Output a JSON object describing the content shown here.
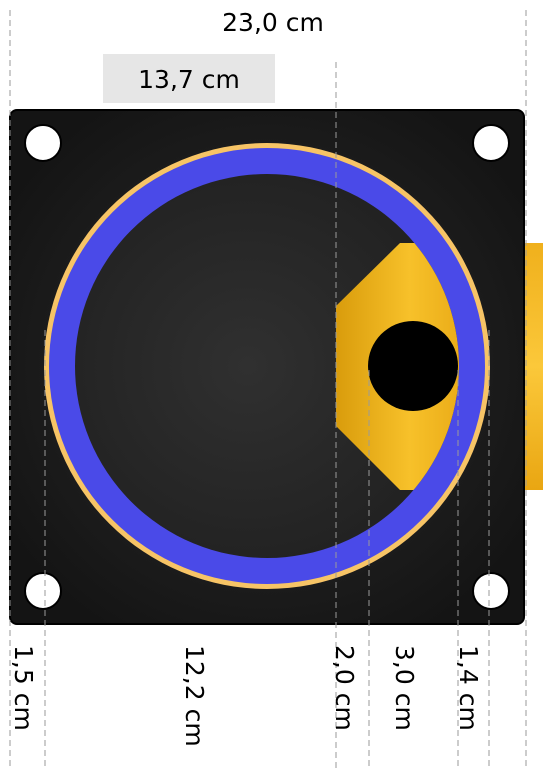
{
  "dimensions": {
    "total_width": "23,0 cm",
    "outer_offset": "13,7 cm",
    "segments": [
      {
        "id": "seg-1",
        "label": "1,5 cm"
      },
      {
        "id": "seg-2",
        "label": "12,2 cm"
      },
      {
        "id": "seg-3",
        "label": "2,0 cm"
      },
      {
        "id": "seg-4",
        "label": "3,0 cm"
      },
      {
        "id": "seg-5",
        "label": "1,4 cm"
      }
    ]
  },
  "colors": {
    "plate": "#1e1e1e",
    "ring": "#4a4ae8",
    "ring_rim": "#f7c466",
    "nozzle": "#f2b51c",
    "outlet_hole": "#000000",
    "mount_hole": "#ffffff",
    "label_box": "#e6e6e6",
    "guide_line": "#9a9a9a"
  }
}
